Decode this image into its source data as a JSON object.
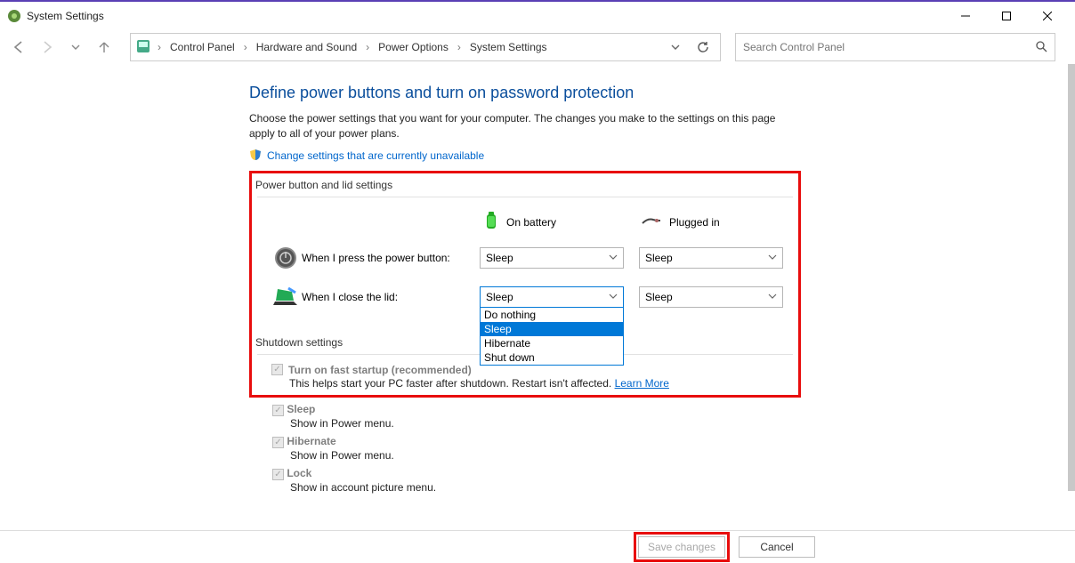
{
  "window": {
    "title": "System Settings"
  },
  "breadcrumb": {
    "items": [
      "Control Panel",
      "Hardware and Sound",
      "Power Options",
      "System Settings"
    ]
  },
  "search": {
    "placeholder": "Search Control Panel"
  },
  "page": {
    "heading": "Define power buttons and turn on password protection",
    "description": "Choose the power settings that you want for your computer. The changes you make to the settings on this page apply to all of your power plans.",
    "change_link": "Change settings that are currently unavailable"
  },
  "power_section": {
    "title": "Power button and lid settings",
    "col_battery": "On battery",
    "col_plugged": "Plugged in",
    "row_power_button": {
      "label": "When I press the power button:",
      "battery_value": "Sleep",
      "plugged_value": "Sleep"
    },
    "row_lid": {
      "label": "When I close the lid:",
      "battery_value": "Sleep",
      "plugged_value": "Sleep"
    },
    "dropdown_options": [
      "Do nothing",
      "Sleep",
      "Hibernate",
      "Shut down"
    ]
  },
  "shutdown_section": {
    "title": "Shutdown settings",
    "fast_startup": {
      "label": "Turn on fast startup (recommended)",
      "desc_prefix": "This helps start your PC faster after shutdown. Restart isn't affected. ",
      "learn_more": "Learn More"
    },
    "sleep": {
      "label": "Sleep",
      "desc": "Show in Power menu."
    },
    "hibernate": {
      "label": "Hibernate",
      "desc": "Show in Power menu."
    },
    "lock": {
      "label": "Lock",
      "desc": "Show in account picture menu."
    }
  },
  "footer": {
    "save": "Save changes",
    "cancel": "Cancel"
  }
}
